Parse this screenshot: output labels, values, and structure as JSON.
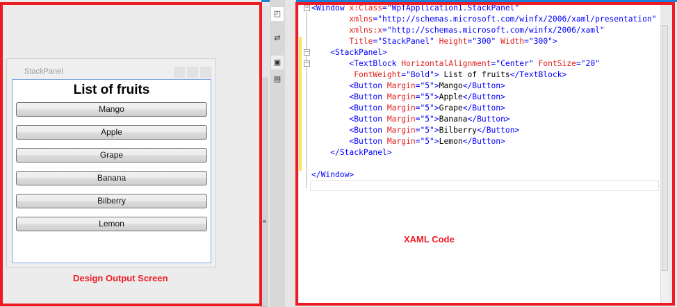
{
  "designer": {
    "window_title": "StackPanel",
    "heading": "List of fruits",
    "buttons": [
      "Mango",
      "Apple",
      "Grape",
      "Banana",
      "Bilberry",
      "Lemon"
    ],
    "caption": "Design Output Screen"
  },
  "editor": {
    "caption": "XAML Code",
    "lines": [
      [
        [
          "b",
          "<"
        ],
        [
          "b",
          "Window"
        ],
        [
          "k",
          " "
        ],
        [
          "r",
          "x:Class"
        ],
        [
          "b",
          "=\"WpfApplication1.StackPanel\""
        ]
      ],
      [
        [
          "k",
          "        "
        ],
        [
          "r",
          "xmlns"
        ],
        [
          "b",
          "=\"http://schemas.microsoft.com/winfx/2006/xaml/presentation\""
        ]
      ],
      [
        [
          "k",
          "        "
        ],
        [
          "r",
          "xmlns:x"
        ],
        [
          "b",
          "=\"http://schemas.microsoft.com/winfx/2006/xaml\""
        ]
      ],
      [
        [
          "k",
          "        "
        ],
        [
          "r",
          "Title"
        ],
        [
          "b",
          "=\"StackPanel\""
        ],
        [
          "k",
          " "
        ],
        [
          "r",
          "Height"
        ],
        [
          "b",
          "=\"300\""
        ],
        [
          "k",
          " "
        ],
        [
          "r",
          "Width"
        ],
        [
          "b",
          "=\"300\">"
        ]
      ],
      [
        [
          "k",
          "    "
        ],
        [
          "b",
          "<StackPanel>"
        ]
      ],
      [
        [
          "k",
          "        "
        ],
        [
          "b",
          "<TextBlock"
        ],
        [
          "k",
          " "
        ],
        [
          "r",
          "HorizontalAlignment"
        ],
        [
          "b",
          "=\"Center\""
        ],
        [
          "k",
          " "
        ],
        [
          "r",
          "FontSize"
        ],
        [
          "b",
          "=\"20\""
        ]
      ],
      [
        [
          "k",
          "         "
        ],
        [
          "r",
          "FontWeight"
        ],
        [
          "b",
          "=\"Bold\">"
        ],
        [
          "k",
          " List of fruits"
        ],
        [
          "b",
          "</TextBlock>"
        ]
      ],
      [
        [
          "k",
          "        "
        ],
        [
          "b",
          "<Button"
        ],
        [
          "k",
          " "
        ],
        [
          "r",
          "Margin"
        ],
        [
          "b",
          "=\"5\">"
        ],
        [
          "k",
          "Mango"
        ],
        [
          "b",
          "</Button>"
        ]
      ],
      [
        [
          "k",
          "        "
        ],
        [
          "b",
          "<Button"
        ],
        [
          "k",
          " "
        ],
        [
          "r",
          "Margin"
        ],
        [
          "b",
          "=\"5\">"
        ],
        [
          "k",
          "Apple"
        ],
        [
          "b",
          "</Button>"
        ]
      ],
      [
        [
          "k",
          "        "
        ],
        [
          "b",
          "<Button"
        ],
        [
          "k",
          " "
        ],
        [
          "r",
          "Margin"
        ],
        [
          "b",
          "=\"5\">"
        ],
        [
          "k",
          "Grape"
        ],
        [
          "b",
          "</Button>"
        ]
      ],
      [
        [
          "k",
          "        "
        ],
        [
          "b",
          "<Button"
        ],
        [
          "k",
          " "
        ],
        [
          "r",
          "Margin"
        ],
        [
          "b",
          "=\"5\">"
        ],
        [
          "k",
          "Banana"
        ],
        [
          "b",
          "</Button>"
        ]
      ],
      [
        [
          "k",
          "        "
        ],
        [
          "b",
          "<Button"
        ],
        [
          "k",
          " "
        ],
        [
          "r",
          "Margin"
        ],
        [
          "b",
          "=\"5\">"
        ],
        [
          "k",
          "Bilberry"
        ],
        [
          "b",
          "</Button>"
        ]
      ],
      [
        [
          "k",
          "        "
        ],
        [
          "b",
          "<Button"
        ],
        [
          "k",
          " "
        ],
        [
          "r",
          "Margin"
        ],
        [
          "b",
          "=\"5\">"
        ],
        [
          "k",
          "Lemon"
        ],
        [
          "b",
          "</Button>"
        ]
      ],
      [
        [
          "k",
          "    "
        ],
        [
          "b",
          "</StackPanel>"
        ]
      ],
      [
        [
          "k",
          ""
        ]
      ],
      [
        [
          "b",
          "</Window>"
        ]
      ]
    ]
  },
  "icons": {
    "design": "design-view-icon",
    "swap": "swap-panes-icon",
    "xaml": "xaml-view-icon",
    "split": "split-view-icon"
  },
  "colors": {
    "highlight": "#ed1c24",
    "accent": "#1e7fd8"
  }
}
